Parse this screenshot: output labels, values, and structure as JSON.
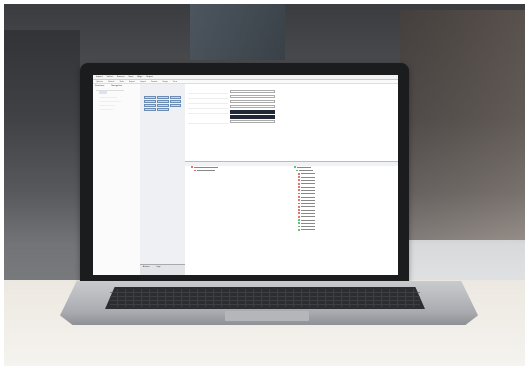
{
  "scene": {
    "description_colors": {
      "accent_red": "#d9534f",
      "accent_green": "#4caf50",
      "dark_field": "#1f2937"
    }
  },
  "app": {
    "menu": [
      "Import",
      "Select",
      "Process",
      "Save",
      "Align",
      "Report"
    ],
    "toolbar": [
      "Options",
      "Default",
      "Tools",
      "Export",
      "Layout",
      "Format",
      "Group",
      "View"
    ],
    "left_tabs": [
      "Structure",
      "Navigation"
    ],
    "center_bottom_tabs": [
      "Actions",
      "Logs"
    ]
  }
}
